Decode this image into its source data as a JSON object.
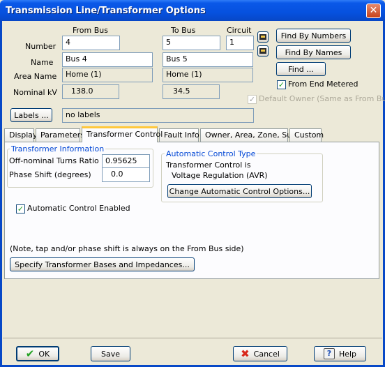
{
  "window": {
    "title": "Transmission Line/Transformer Options",
    "close": "✕"
  },
  "headers": {
    "from_bus": "From Bus",
    "to_bus": "To Bus",
    "circuit": "Circuit"
  },
  "labels": {
    "number": "Number",
    "name": "Name",
    "area_name": "Area Name",
    "nominal_kv": "Nominal kV"
  },
  "from": {
    "number": "4",
    "name": "Bus 4",
    "area": "Home (1)",
    "kv": "138.0"
  },
  "to": {
    "number": "5",
    "name": "Bus 5",
    "area": "Home (1)",
    "kv": "34.5"
  },
  "circuit": "1",
  "buttons": {
    "find_by_numbers": "Find By Numbers",
    "find_by_names": "Find By Names",
    "find": "Find ...",
    "labels": "Labels ...",
    "change_auto": "Change Automatic Control Options...",
    "specify_bases": "Specify Transformer Bases and Impedances...",
    "ok": "OK",
    "save": "Save",
    "cancel": "Cancel",
    "help": "Help"
  },
  "checks": {
    "from_end_metered": "From End Metered",
    "default_owner": "Default Owner (Same as From Bus)",
    "auto_control": "Automatic Control Enabled"
  },
  "labels_value": "no labels",
  "tabs": [
    "Display",
    "Parameters",
    "Transformer Control",
    "Fault Info",
    "Owner, Area, Zone, Sub",
    "Custom"
  ],
  "transformer": {
    "group_title": "Transformer Information",
    "turns_label": "Off-nominal Turns Ratio",
    "turns_value": "0.95625",
    "phase_label": "Phase Shift (degrees)",
    "phase_value": "0.0"
  },
  "auto_control": {
    "group_title": "Automatic Control Type",
    "line1": "Transformer Control is",
    "line2": "Voltage Regulation (AVR)"
  },
  "note": "(Note, tap and/or phase shift is always on the From Bus side)",
  "colors": {
    "title_bar": "#0651df",
    "tab_highlight": "#ffc83c",
    "group_title": "#0046d5",
    "ok_check": "#21a121",
    "cancel_x": "#d8281c"
  }
}
